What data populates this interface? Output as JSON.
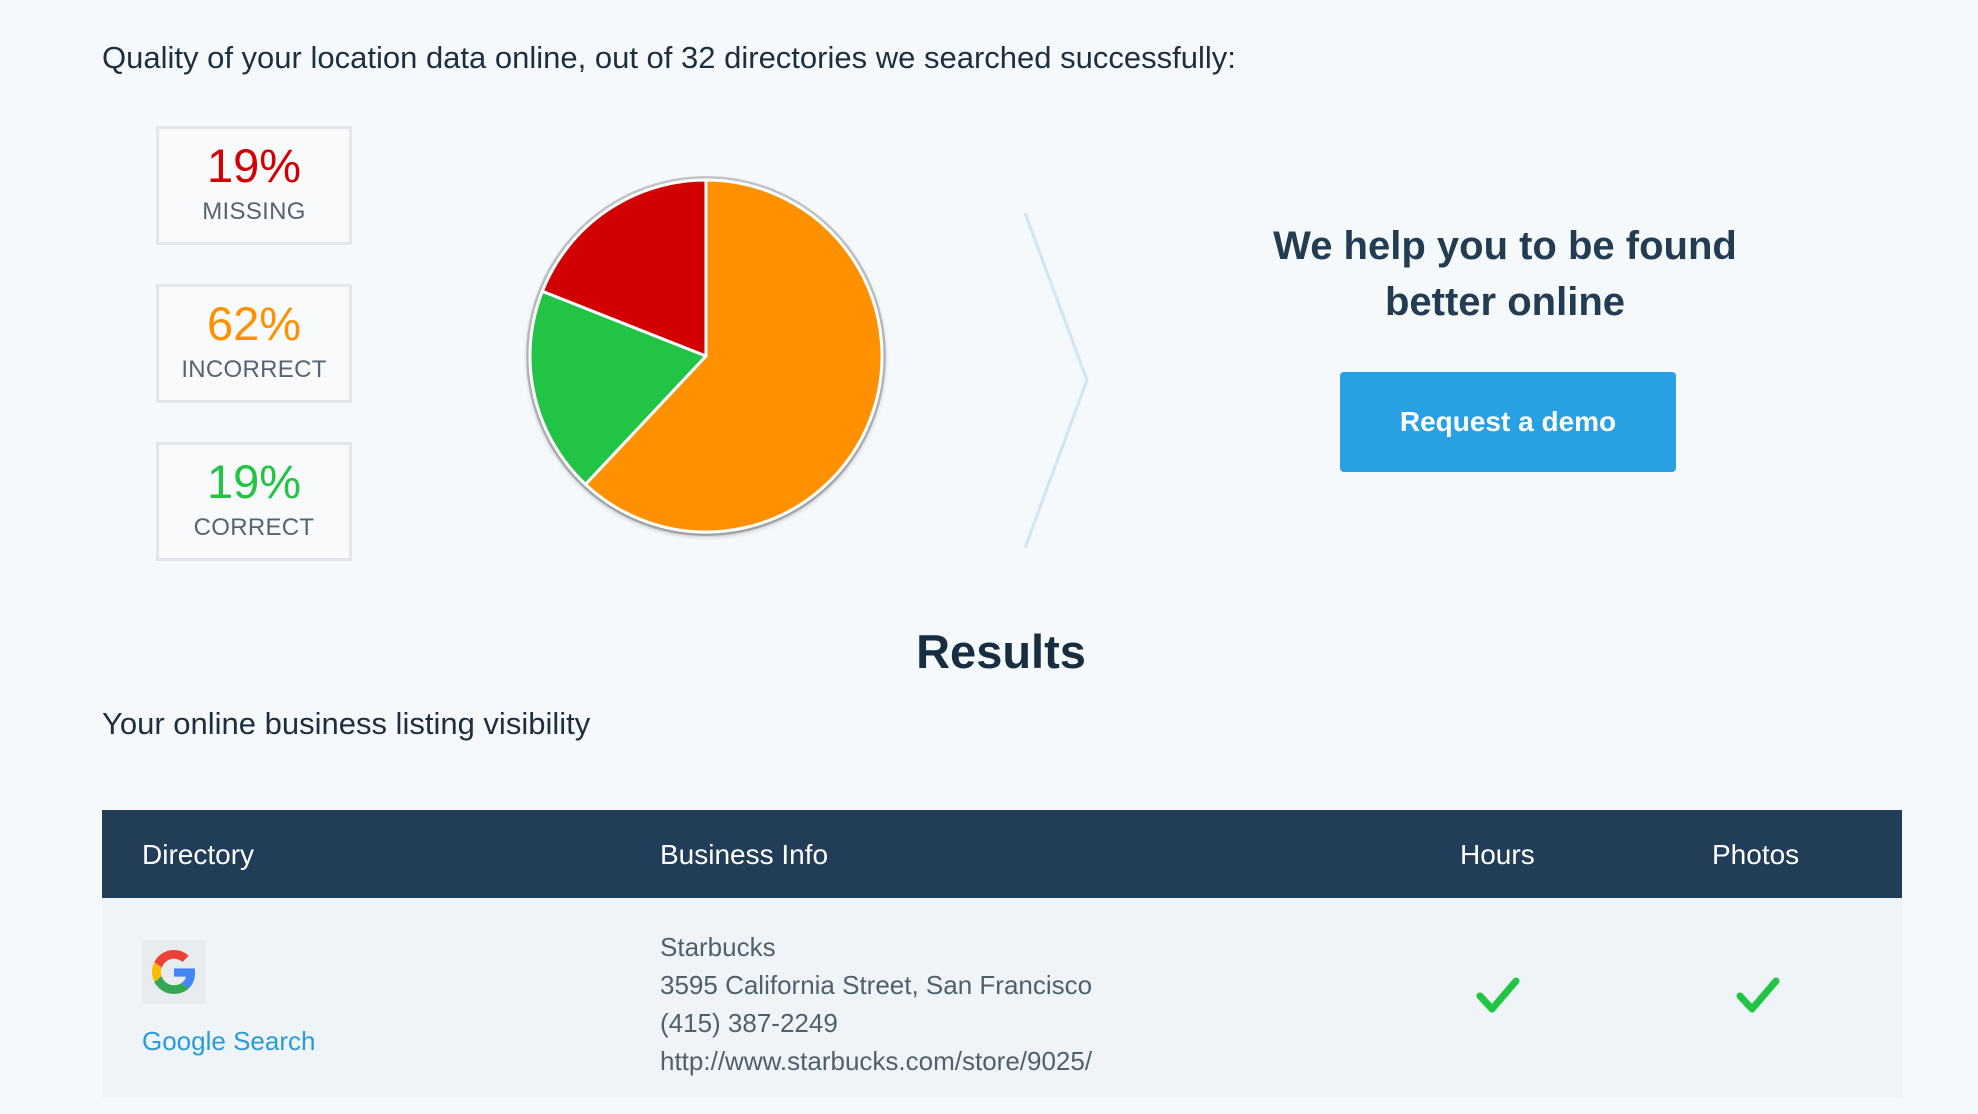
{
  "header": {
    "intro": "Quality of your location data online, out of 32 directories we searched successfully:"
  },
  "stats": [
    {
      "pct": "19%",
      "label": "MISSING",
      "color": "#d20000"
    },
    {
      "pct": "62%",
      "label": "INCORRECT",
      "color": "#ff9100"
    },
    {
      "pct": "19%",
      "label": "CORRECT",
      "color": "#22c444"
    }
  ],
  "chart_data": {
    "type": "pie",
    "categories": [
      "INCORRECT",
      "CORRECT",
      "MISSING"
    ],
    "values": [
      62,
      19,
      19
    ],
    "colors": [
      "#ff9100",
      "#22c444",
      "#d20000"
    ]
  },
  "cta": {
    "title_line1": "We help you to be found",
    "title_line2": "better online",
    "button": "Request a demo"
  },
  "results": {
    "title": "Results",
    "subtitle": "Your online business listing visibility",
    "columns": [
      "Directory",
      "Business Info",
      "Hours",
      "Photos"
    ],
    "rows": [
      {
        "directory": "Google Search",
        "icon": "google-icon",
        "name": "Starbucks",
        "address": "3595 California Street, San Francisco",
        "phone": "(415) 387-2249",
        "url": "http://www.starbucks.com/store/9025/",
        "hours": true,
        "photos": true
      }
    ]
  },
  "colors": {
    "accent": "#28a0e4",
    "header_bg": "#223d57",
    "check": "#22c444"
  }
}
